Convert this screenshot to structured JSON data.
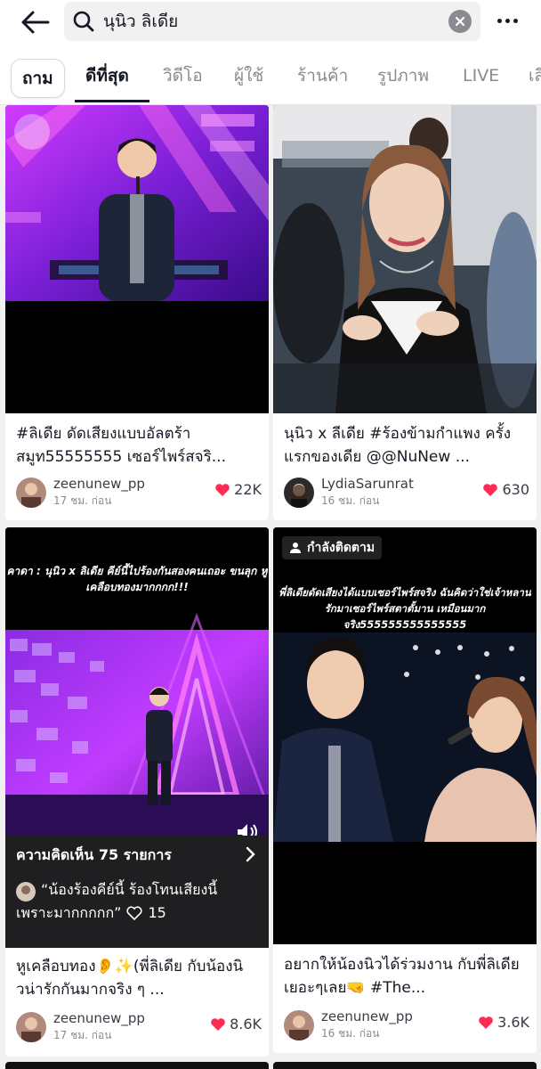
{
  "search": {
    "query": "นุนิว ลิเดีย"
  },
  "tabs": [
    {
      "label": "ถาม"
    },
    {
      "label": "ดีที่สุด"
    },
    {
      "label": "วิดีโอ"
    },
    {
      "label": "ผู้ใช้"
    },
    {
      "label": "ร้านค้า"
    },
    {
      "label": "รูปภาพ"
    },
    {
      "label": "LIVE"
    },
    {
      "label": "เสี"
    }
  ],
  "cards": [
    {
      "caption": "#ลิเดีย ดัดเสียงแบบอัลตร้าสมูท55555555 เซอร์ไพร์สจริ...",
      "author": "zeenunew_pp",
      "time": "17 ชม. ก่อน",
      "likes": "22K"
    },
    {
      "caption": "นุนิว x ลีเดีย #ร้องข้ามกำแพง ครั้งแรกของเดีย @@NuNew ...",
      "author": "LydiaSarunrat",
      "time": "16 ชม. ก่อน",
      "likes": "630"
    },
    {
      "overlay": "คาดา : นุนิว x ลิเดีย คีย์นี้ไปร้องกันสองคนเถอะ ขนลุก หูเคลือบทองมากกกก!!!",
      "comments_title": "ความคิดเห็น 75 รายการ",
      "comment_text": "“น้องร้องคีย์นี้ ร้องโทนเสียงนี้",
      "comment_text2": "เพราะมากกกกก”",
      "comment_likes": "15",
      "caption": "หูเคลือบทอง👂✨(พี่ลิเดีย กับน้องนิวน่ารักกันมากจริง ๆ ...",
      "author": "zeenunew_pp",
      "time": "17 ชม. ก่อน",
      "likes": "8.6K"
    },
    {
      "badge": "กำลังติดตาม",
      "overlay": "พี่ลิเดียดัดเสียงได้แบบเซอร์ไพร์สจริง ฉันคิดว่าใช่เจ้าหลานรักมาเซอร์ไพร์สตาตั้มาน เหมือนมากจริง555555555555555",
      "caption": "อยากให้น้องนิวได้ร่วมงาน กับพี่ลิเดียเยอะๆเลย🤜 #The...",
      "author": "zeenunew_pp",
      "time": "16 ชม. ก่อน",
      "likes": "3.6K"
    }
  ],
  "colors": {
    "like_heart": "#fe2c55",
    "accent_purple": "#b23cff",
    "text_primary": "#161823",
    "text_secondary": "#8a8b91"
  }
}
